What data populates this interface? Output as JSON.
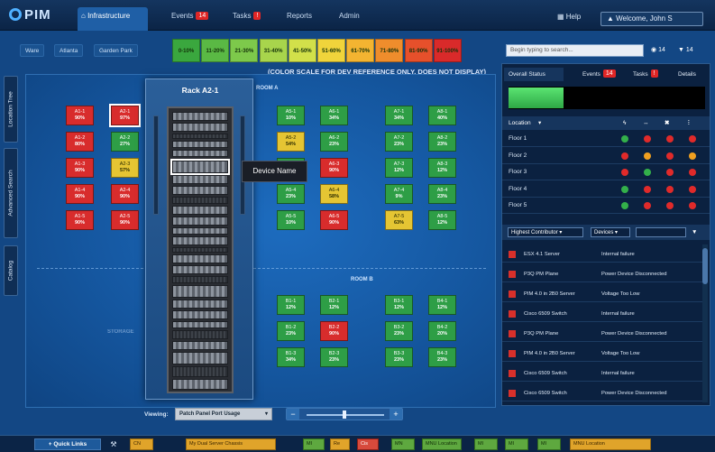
{
  "app": {
    "logo": "PIM"
  },
  "nav": {
    "tabs": [
      {
        "label": "Infrastructure",
        "badge": ""
      },
      {
        "label": "Events",
        "badge": "14"
      },
      {
        "label": "Tasks",
        "badge": "!"
      },
      {
        "label": "Reports",
        "badge": ""
      },
      {
        "label": "Admin",
        "badge": ""
      }
    ],
    "help": "Help",
    "welcome": "Welcome, John S"
  },
  "breadcrumb": [
    "Ware",
    "Atlanta",
    "Garden Park"
  ],
  "color_scale": [
    {
      "label": "0-10%",
      "color": "#3aa73e"
    },
    {
      "label": "11-20%",
      "color": "#5ab944"
    },
    {
      "label": "21-30%",
      "color": "#7dc94b"
    },
    {
      "label": "31-40%",
      "color": "#a8d54c"
    },
    {
      "label": "41-50%",
      "color": "#d2e04a"
    },
    {
      "label": "51-60%",
      "color": "#f0d43b"
    },
    {
      "label": "61-70%",
      "color": "#f3b431"
    },
    {
      "label": "71-80%",
      "color": "#ef8d2c"
    },
    {
      "label": "81-90%",
      "color": "#e6502b"
    },
    {
      "label": "91-100%",
      "color": "#d92a2a"
    }
  ],
  "scale_note": "(COLOR SCALE FOR DEV REFERENCE ONLY, DOES NOT DISPLAY)",
  "search": {
    "placeholder": "Begin typing to search...",
    "count1": "14",
    "count2": "14"
  },
  "left_tabs": [
    "Location Tree",
    "Advanced Search",
    "Catalog"
  ],
  "floor": {
    "room_a_label": "ROOM A",
    "room_b_label": "ROOM B",
    "room_c_label": "STORAGE"
  },
  "racks": [
    {
      "id": "A1-1",
      "pct": "90%",
      "s": "r"
    },
    {
      "id": "A1-2",
      "pct": "80%",
      "s": "r"
    },
    {
      "id": "A1-3",
      "pct": "90%",
      "s": "r"
    },
    {
      "id": "A1-4",
      "pct": "90%",
      "s": "r"
    },
    {
      "id": "A1-5",
      "pct": "90%",
      "s": "r"
    },
    {
      "id": "A2-1",
      "pct": "97%",
      "s": "r"
    },
    {
      "id": "A2-2",
      "pct": "27%",
      "s": "g"
    },
    {
      "id": "A2-3",
      "pct": "57%",
      "s": "y"
    },
    {
      "id": "A2-4",
      "pct": "90%",
      "s": "r"
    },
    {
      "id": "A2-5",
      "pct": "90%",
      "s": "r"
    },
    {
      "id": "A5-1",
      "pct": "10%",
      "s": "g"
    },
    {
      "id": "A5-2",
      "pct": "54%",
      "s": "y"
    },
    {
      "id": "A5-3",
      "pct": "10%",
      "s": "g"
    },
    {
      "id": "A5-4",
      "pct": "23%",
      "s": "g"
    },
    {
      "id": "A5-5",
      "pct": "10%",
      "s": "g"
    },
    {
      "id": "A6-1",
      "pct": "34%",
      "s": "g"
    },
    {
      "id": "A6-2",
      "pct": "23%",
      "s": "g"
    },
    {
      "id": "A6-3",
      "pct": "90%",
      "s": "r"
    },
    {
      "id": "A6-4",
      "pct": "58%",
      "s": "y"
    },
    {
      "id": "A6-5",
      "pct": "90%",
      "s": "r"
    },
    {
      "id": "A7-1",
      "pct": "34%",
      "s": "g"
    },
    {
      "id": "A7-2",
      "pct": "23%",
      "s": "g"
    },
    {
      "id": "A7-3",
      "pct": "12%",
      "s": "g"
    },
    {
      "id": "A7-4",
      "pct": "9%",
      "s": "g"
    },
    {
      "id": "A7-5",
      "pct": "63%",
      "s": "y"
    },
    {
      "id": "A8-1",
      "pct": "40%",
      "s": "g"
    },
    {
      "id": "A8-2",
      "pct": "23%",
      "s": "g"
    },
    {
      "id": "A8-3",
      "pct": "12%",
      "s": "g"
    },
    {
      "id": "A8-4",
      "pct": "23%",
      "s": "g"
    },
    {
      "id": "A8-5",
      "pct": "12%",
      "s": "g"
    },
    {
      "id": "B1-1",
      "pct": "12%",
      "s": "g"
    },
    {
      "id": "B1-2",
      "pct": "23%",
      "s": "g"
    },
    {
      "id": "B1-3",
      "pct": "34%",
      "s": "g"
    },
    {
      "id": "B2-1",
      "pct": "12%",
      "s": "g"
    },
    {
      "id": "B2-2",
      "pct": "90%",
      "s": "r"
    },
    {
      "id": "B2-3",
      "pct": "23%",
      "s": "g"
    },
    {
      "id": "B3-1",
      "pct": "12%",
      "s": "g"
    },
    {
      "id": "B3-2",
      "pct": "23%",
      "s": "g"
    },
    {
      "id": "B3-3",
      "pct": "23%",
      "s": "g"
    },
    {
      "id": "B4-1",
      "pct": "12%",
      "s": "g"
    },
    {
      "id": "B4-2",
      "pct": "20%",
      "s": "g"
    },
    {
      "id": "B4-3",
      "pct": "23%",
      "s": "g"
    }
  ],
  "rack_popup": {
    "title": "Rack A2-1",
    "device_tooltip": "Device Name"
  },
  "viewing": {
    "label": "Viewing:",
    "value": "Patch Panel Port Usage",
    "zoom_minus": "−",
    "zoom_plus": "+"
  },
  "right_panel": {
    "tabs": [
      {
        "label": "Overall Status",
        "badge": ""
      },
      {
        "label": "Events",
        "badge": "14"
      },
      {
        "label": "Tasks",
        "badge": "!"
      },
      {
        "label": "Details",
        "badge": ""
      }
    ],
    "overall_status_pct": 0.28,
    "location_header": "Location",
    "locations": [
      {
        "name": "Floor 1",
        "dots": [
          "g",
          "r",
          "r",
          "r"
        ]
      },
      {
        "name": "Floor 2",
        "dots": [
          "r",
          "o",
          "r",
          "o"
        ]
      },
      {
        "name": "Floor 3",
        "dots": [
          "r",
          "g",
          "r",
          "r"
        ]
      },
      {
        "name": "Floor 4",
        "dots": [
          "g",
          "r",
          "r",
          "r"
        ]
      },
      {
        "name": "Floor 5",
        "dots": [
          "g",
          "r",
          "r",
          "r"
        ]
      }
    ],
    "contributor_header": "Highest Contributor",
    "devices_dropdown": "Devices",
    "alerts": [
      {
        "device": "ESX 4.1 Server",
        "desc": "Internal failure"
      },
      {
        "device": "P3Q PM Plane",
        "desc": "Power Device Disconnected"
      },
      {
        "device": "PIM 4.0 in 2B0 Server",
        "desc": "Voltage Too Low"
      },
      {
        "device": "Cisco 6509 Switch",
        "desc": "Internal failure"
      },
      {
        "device": "P3Q PM Plane",
        "desc": "Power Device Disconnected"
      },
      {
        "device": "PIM 4.0 in 2B0 Server",
        "desc": "Voltage Too Low"
      },
      {
        "device": "Cisco 6509 Switch",
        "desc": "Internal failure"
      },
      {
        "device": "Cisco 6509 Switch",
        "desc": "Power Device Disconnected"
      }
    ]
  },
  "quick_links": {
    "label": "Quick Links",
    "items": [
      {
        "label": "CN",
        "kind": "orange"
      },
      {
        "label": "My Dual Server Chassis",
        "kind": "orange"
      },
      {
        "label": "MI",
        "kind": "green"
      },
      {
        "label": "Re",
        "kind": "orange"
      },
      {
        "label": "Cis",
        "kind": "red"
      },
      {
        "label": "MN",
        "kind": "green"
      },
      {
        "label": "MNU Location",
        "kind": "green"
      },
      {
        "label": "MI",
        "kind": "green"
      },
      {
        "label": "MI",
        "kind": "green"
      },
      {
        "label": "MI",
        "kind": "green"
      },
      {
        "label": "MNU Location",
        "kind": "orange"
      }
    ]
  }
}
